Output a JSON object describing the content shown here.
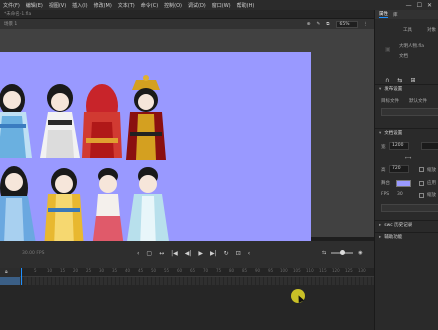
{
  "menubar": {
    "items": [
      "文件(F)",
      "编辑(E)",
      "视图(V)",
      "插入(I)",
      "修改(M)",
      "文本(T)",
      "命令(C)",
      "控制(O)",
      "调试(D)",
      "窗口(W)",
      "帮助(H)"
    ],
    "window_controls": [
      "—",
      "☐",
      "✕"
    ]
  },
  "document": {
    "tab": "*未命名-1.fla",
    "scene": "场景 1",
    "zoom": "65%"
  },
  "timeline": {
    "fps_label": "30.00 FPS",
    "ticks": [
      "5",
      "10",
      "15",
      "20",
      "25",
      "30",
      "35",
      "40",
      "45",
      "50",
      "55",
      "60",
      "65",
      "70",
      "75",
      "80",
      "85",
      "90",
      "95",
      "100",
      "105",
      "110",
      "115",
      "120",
      "125",
      "130",
      "135"
    ],
    "controls": [
      "‹",
      "▢",
      "↔",
      "|◀",
      "◀|",
      "▶",
      "▶|",
      "↻",
      "⊡",
      "‹"
    ],
    "right_controls": [
      "⇆",
      "◉"
    ]
  },
  "panel": {
    "tabs": [
      "属性",
      "库"
    ],
    "labels": {
      "tools_tab": "工具",
      "object_tab": "对象",
      "doc_name": "大明人物.fla",
      "doc_kind": "文档",
      "publish_settings": "发布设置",
      "target_label": "目标文件",
      "target_value": "默认文件",
      "doc_settings": "文档设置",
      "width_label": "宽",
      "width_value": "1200",
      "height_label": "高",
      "height_value": "720",
      "stage_label": "舞台",
      "scale_label": "缩放",
      "apply_label": "应用",
      "fps_label": "FPS",
      "fps_value": "30",
      "history": "swc 历史记录",
      "accessibility": "辅助功能"
    }
  },
  "colors": {
    "stage": "#9999ff",
    "accent": "#1e90ff"
  }
}
